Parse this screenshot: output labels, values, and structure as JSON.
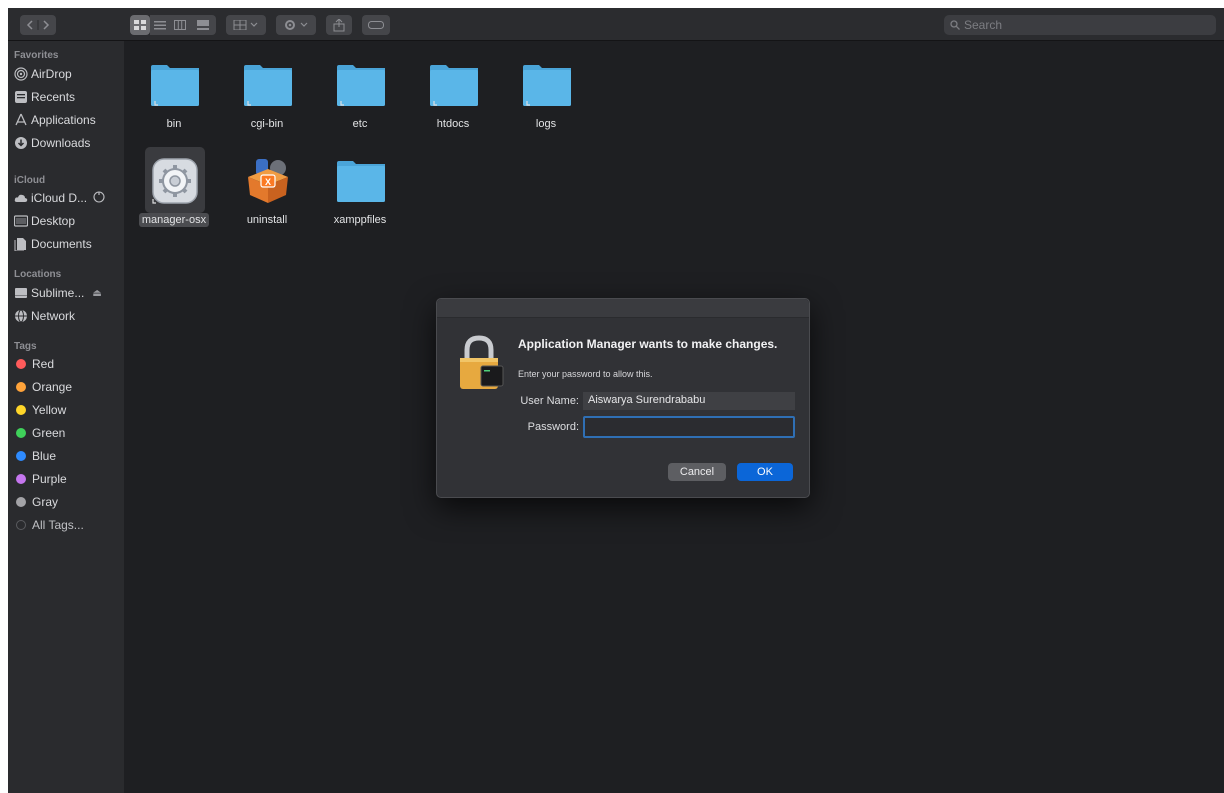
{
  "toolbar": {
    "search_placeholder": "Search"
  },
  "sidebar": {
    "favorites_title": "Favorites",
    "favorites": [
      {
        "label": "AirDrop",
        "icon": "airdrop-icon"
      },
      {
        "label": "Recents",
        "icon": "recents-icon"
      },
      {
        "label": "Applications",
        "icon": "applications-icon"
      },
      {
        "label": "Downloads",
        "icon": "downloads-icon"
      }
    ],
    "icloud_title": "iCloud",
    "icloud": [
      {
        "label": "iCloud D...",
        "icon": "cloud-icon"
      },
      {
        "label": "Desktop",
        "icon": "desktop-icon"
      },
      {
        "label": "Documents",
        "icon": "documents-icon"
      }
    ],
    "locations_title": "Locations",
    "locations": [
      {
        "label": "Sublime...",
        "icon": "disk-icon"
      },
      {
        "label": "Network",
        "icon": "network-icon"
      }
    ],
    "tags_title": "Tags",
    "tags": [
      {
        "label": "Red",
        "color": "#ff5b5b"
      },
      {
        "label": "Orange",
        "color": "#ffa33a"
      },
      {
        "label": "Yellow",
        "color": "#ffd629"
      },
      {
        "label": "Green",
        "color": "#3fd15a"
      },
      {
        "label": "Blue",
        "color": "#2e8bff"
      },
      {
        "label": "Purple",
        "color": "#c576ef"
      },
      {
        "label": "Gray",
        "color": "#a3a3a7"
      },
      {
        "label": "All Tags...",
        "color": "#5a5b5f"
      }
    ]
  },
  "files": [
    {
      "name": "bin",
      "type": "folder"
    },
    {
      "name": "cgi-bin",
      "type": "folder"
    },
    {
      "name": "etc",
      "type": "folder"
    },
    {
      "name": "htdocs",
      "type": "folder"
    },
    {
      "name": "logs",
      "type": "folder"
    },
    {
      "name": "manager-osx",
      "type": "app",
      "selected": true
    },
    {
      "name": "uninstall",
      "type": "app"
    },
    {
      "name": "xamppfiles",
      "type": "folder"
    }
  ],
  "dialog": {
    "title": "Application Manager wants to make changes.",
    "subtitle": "Enter your password to allow this.",
    "username_label": "User Name:",
    "username_value": "Aiswarya Surendrababu",
    "password_label": "Password:",
    "password_value": "",
    "cancel_label": "Cancel",
    "ok_label": "OK"
  },
  "colors": {
    "accent": "#0b66d8",
    "folder": "#5ab6e8"
  }
}
